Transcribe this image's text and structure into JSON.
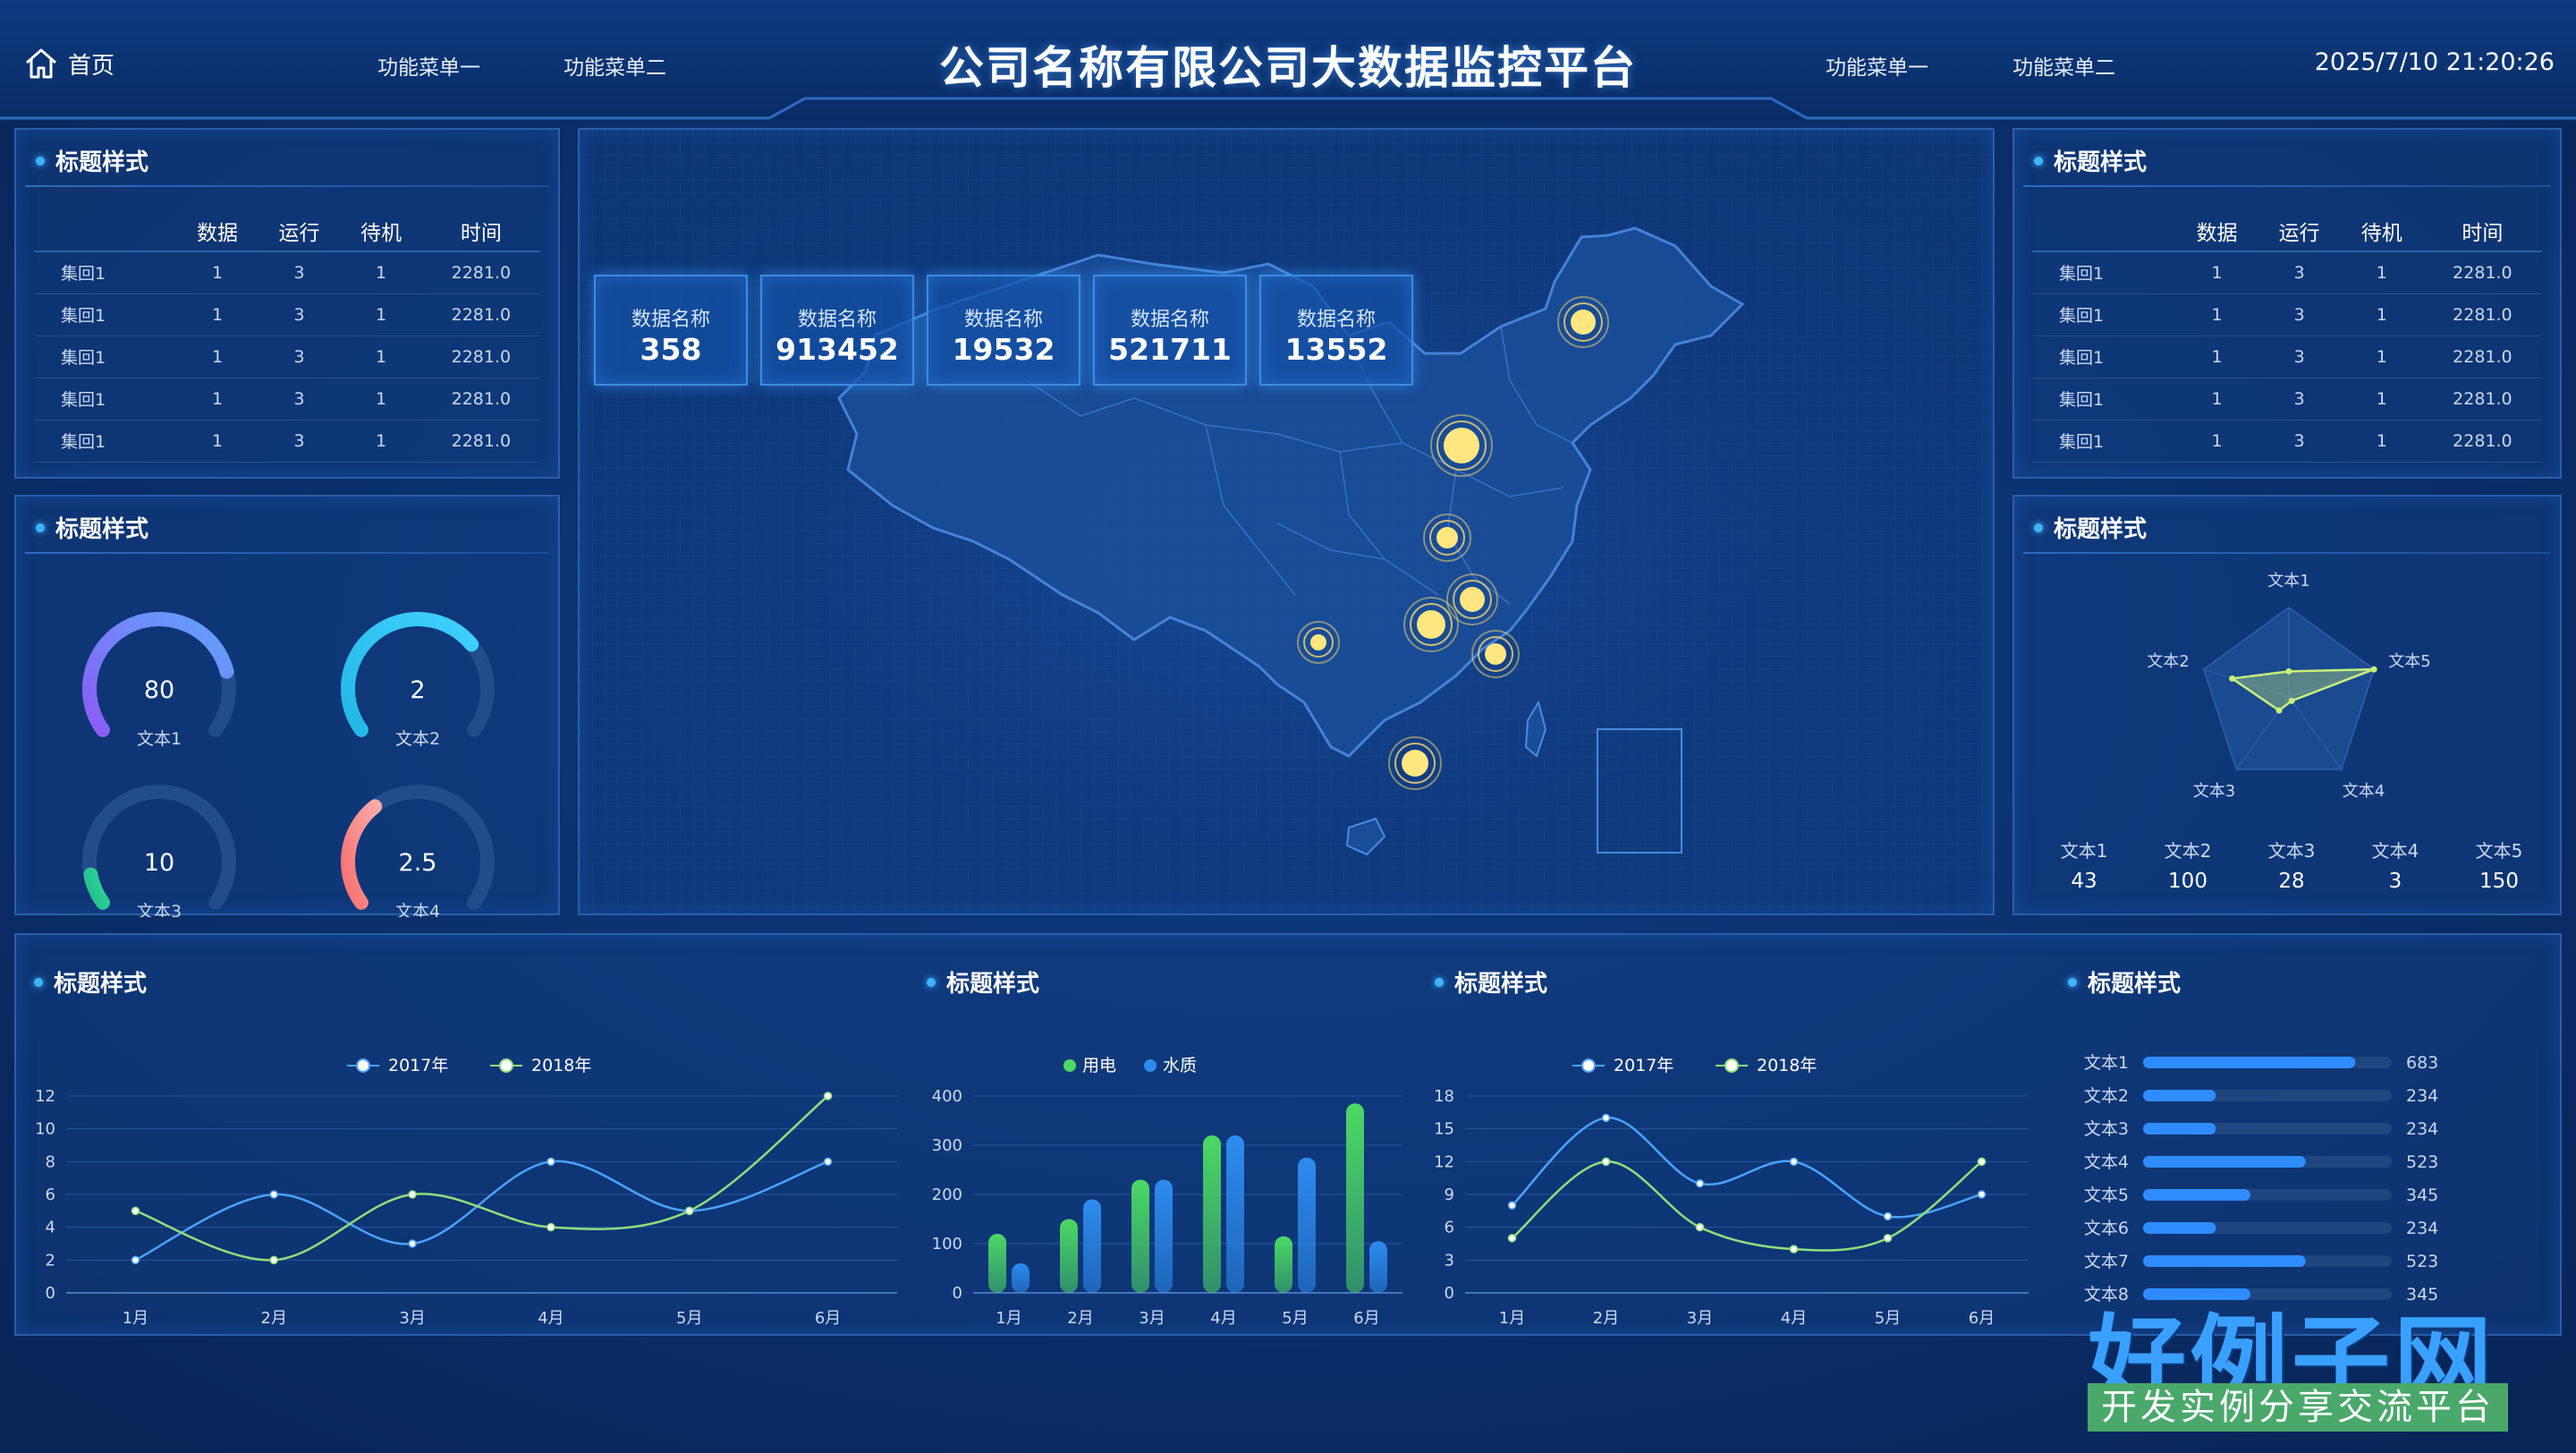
{
  "header": {
    "home_label": "首页",
    "menu_left": [
      "功能菜单一",
      "功能菜单二"
    ],
    "title": "公司名称有限公司大数据监控平台",
    "menu_right": [
      "功能菜单一",
      "功能菜单二"
    ],
    "clock": "2025/7/10 21:20:26"
  },
  "panel_title": "标题样式",
  "table": {
    "headers": [
      "",
      "数据",
      "运行",
      "待机",
      "时间"
    ],
    "rows": [
      [
        "集回1",
        "1",
        "3",
        "1",
        "2281.0"
      ],
      [
        "集回1",
        "1",
        "3",
        "1",
        "2281.0"
      ],
      [
        "集回1",
        "1",
        "3",
        "1",
        "2281.0"
      ],
      [
        "集回1",
        "1",
        "3",
        "1",
        "2281.0"
      ],
      [
        "集回1",
        "1",
        "3",
        "1",
        "2281.0"
      ]
    ]
  },
  "gauges": [
    {
      "value": "80",
      "label": "文本1",
      "fraction": 0.8,
      "color_a": "#8b5cf6",
      "color_b": "#60a5fa"
    },
    {
      "value": "2",
      "label": "文本2",
      "fraction": 0.7,
      "color_a": "#22b8e6",
      "color_b": "#3fd0ff"
    },
    {
      "value": "10",
      "label": "文本3",
      "fraction": 0.1,
      "color_a": "#1fbf8f",
      "color_b": "#34d399"
    },
    {
      "value": "2.5",
      "label": "文本4",
      "fraction": 0.35,
      "color_a": "#f87171",
      "color_b": "#f9a8a8"
    }
  ],
  "stats": [
    {
      "label": "数据名称",
      "value": "358"
    },
    {
      "label": "数据名称",
      "value": "913452"
    },
    {
      "label": "数据名称",
      "value": "19532"
    },
    {
      "label": "数据名称",
      "value": "521711"
    },
    {
      "label": "数据名称",
      "value": "13552"
    }
  ],
  "radar": {
    "labels": [
      "文本1",
      "文本2",
      "文本3",
      "文本4",
      "文本5"
    ],
    "values": [
      43,
      100,
      28,
      3,
      150
    ]
  },
  "radar_stats": [
    {
      "label": "文本1",
      "value": "43"
    },
    {
      "label": "文本2",
      "value": "100"
    },
    {
      "label": "文本3",
      "value": "28"
    },
    {
      "label": "文本4",
      "value": "3"
    },
    {
      "label": "文本5",
      "value": "150"
    }
  ],
  "chart_data": [
    {
      "type": "line",
      "x": [
        "1月",
        "2月",
        "3月",
        "4月",
        "5月",
        "6月"
      ],
      "ylim": [
        0,
        12
      ],
      "yticks": [
        0,
        2,
        4,
        6,
        8,
        10,
        12
      ],
      "series": [
        {
          "name": "2017年",
          "values": [
            2,
            6,
            3,
            8,
            5,
            8
          ],
          "color": "#4aa3ff"
        },
        {
          "name": "2018年",
          "values": [
            5,
            2,
            6,
            4,
            5,
            12
          ],
          "color": "#8fe07a"
        }
      ]
    },
    {
      "type": "bar",
      "categories": [
        "1月",
        "2月",
        "3月",
        "4月",
        "5月",
        "6月"
      ],
      "ylim": [
        0,
        400
      ],
      "yticks": [
        0,
        100,
        200,
        300,
        400
      ],
      "series": [
        {
          "name": "用电",
          "values": [
            120,
            150,
            230,
            320,
            115,
            385
          ],
          "color": "#4cd964"
        },
        {
          "name": "水质",
          "values": [
            60,
            190,
            230,
            320,
            275,
            105
          ],
          "color": "#2d8cf0"
        }
      ]
    },
    {
      "type": "line",
      "x": [
        "1月",
        "2月",
        "3月",
        "4月",
        "5月",
        "6月"
      ],
      "ylim": [
        0,
        18
      ],
      "yticks": [
        0,
        3,
        6,
        9,
        12,
        15,
        18
      ],
      "series": [
        {
          "name": "2017年",
          "values": [
            8,
            16,
            10,
            12,
            7,
            9
          ],
          "color": "#4aa3ff"
        },
        {
          "name": "2018年",
          "values": [
            5,
            12,
            6,
            4,
            5,
            12
          ],
          "color": "#8fe07a"
        }
      ]
    },
    {
      "type": "bar",
      "orientation": "horizontal",
      "categories": [
        "文本1",
        "文本2",
        "文本3",
        "文本4",
        "文本5",
        "文本6",
        "文本7",
        "文本8"
      ],
      "values": [
        683,
        234,
        234,
        523,
        345,
        234,
        523,
        345
      ],
      "value_labels": [
        "683",
        "234",
        "234",
        "523",
        "345",
        "234",
        "523",
        "345"
      ],
      "color": "#2f8cff"
    }
  ],
  "watermark": {
    "big": "好例子网",
    "small": "开发实例分享交流平台"
  }
}
